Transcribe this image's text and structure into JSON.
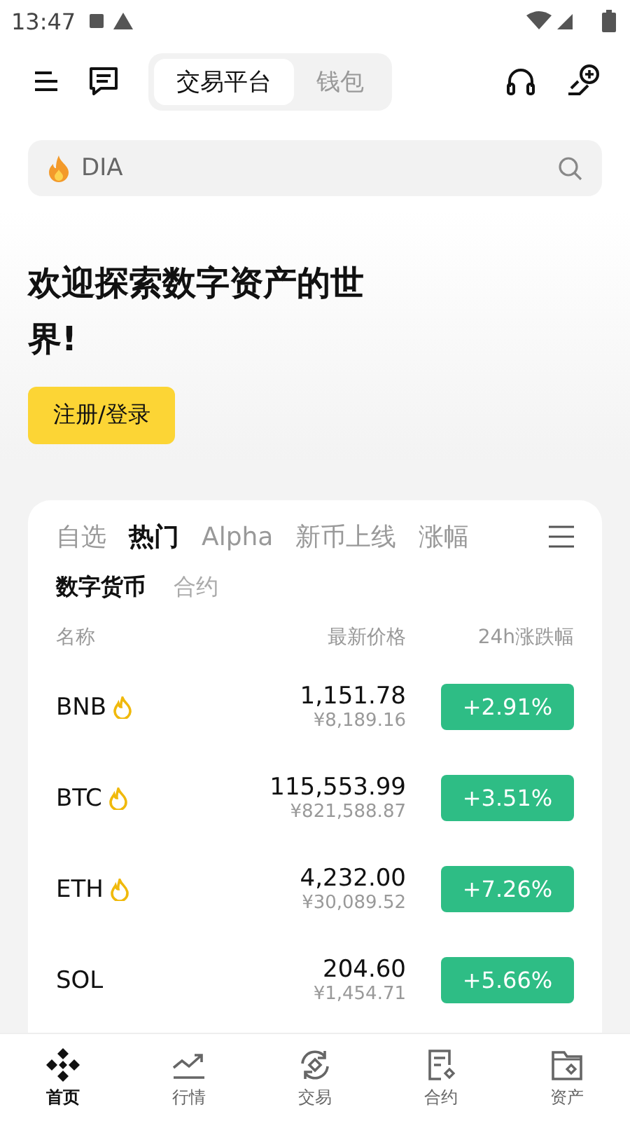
{
  "status_bar": {
    "time": "13:47"
  },
  "header": {
    "tabs": [
      {
        "label": "交易平台",
        "selected": true
      },
      {
        "label": "钱包",
        "selected": false
      }
    ]
  },
  "search": {
    "placeholder": "DIA"
  },
  "hero": {
    "title": "欢迎探索数字资产的世界!",
    "button": "注册/登录"
  },
  "market": {
    "tabs": [
      {
        "label": "自选",
        "selected": false
      },
      {
        "label": "热门",
        "selected": true
      },
      {
        "label": "Alpha",
        "selected": false
      },
      {
        "label": "新币上线",
        "selected": false
      },
      {
        "label": "涨幅",
        "selected": false
      }
    ],
    "subtabs": [
      {
        "label": "数字货币",
        "selected": true
      },
      {
        "label": "合约",
        "selected": false
      }
    ],
    "columns": [
      "名称",
      "最新价格",
      "24h涨跌幅"
    ],
    "rows": [
      {
        "symbol": "BNB",
        "hot": true,
        "price": "1,151.78",
        "cny": "¥8,189.16",
        "change": "+2.91%"
      },
      {
        "symbol": "BTC",
        "hot": true,
        "price": "115,553.99",
        "cny": "¥821,588.87",
        "change": "+3.51%"
      },
      {
        "symbol": "ETH",
        "hot": true,
        "price": "4,232.00",
        "cny": "¥30,089.52",
        "change": "+7.26%"
      },
      {
        "symbol": "SOL",
        "hot": false,
        "price": "204.60",
        "cny": "¥1,454.71",
        "change": "+5.66%"
      }
    ]
  },
  "bottom_nav": [
    {
      "label": "首页",
      "kind": "home",
      "selected": true
    },
    {
      "label": "行情",
      "kind": "markets",
      "selected": false
    },
    {
      "label": "交易",
      "kind": "trade",
      "selected": false
    },
    {
      "label": "合约",
      "kind": "futures",
      "selected": false
    },
    {
      "label": "资产",
      "kind": "assets",
      "selected": false
    }
  ]
}
